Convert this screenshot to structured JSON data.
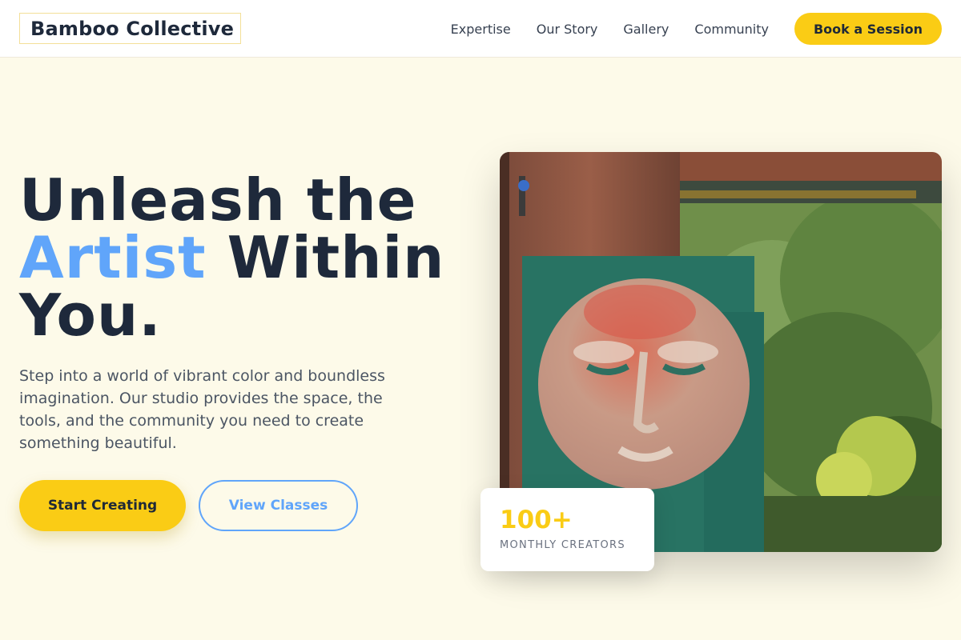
{
  "header": {
    "logo": "Bamboo Collective",
    "nav": [
      {
        "label": "Expertise"
      },
      {
        "label": "Our Story"
      },
      {
        "label": "Gallery"
      },
      {
        "label": "Community"
      }
    ],
    "cta_label": "Book a Session"
  },
  "hero": {
    "headline_line1": "Unleash the",
    "headline_accent": "Artist",
    "headline_line2_rest": " Within",
    "headline_line3": "You.",
    "description": "Step into a world of vibrant color and boundless imagination. Our studio provides the space, the tools, and the community you need to create something beautiful.",
    "primary_button": "Start Creating",
    "secondary_button": "View Classes"
  },
  "stat": {
    "value": "100+",
    "label": "MONTHLY CREATORS"
  },
  "colors": {
    "accent_yellow": "#facc15",
    "accent_blue": "#60a5fa",
    "background": "#fdfae9",
    "text_dark": "#1e293b"
  }
}
